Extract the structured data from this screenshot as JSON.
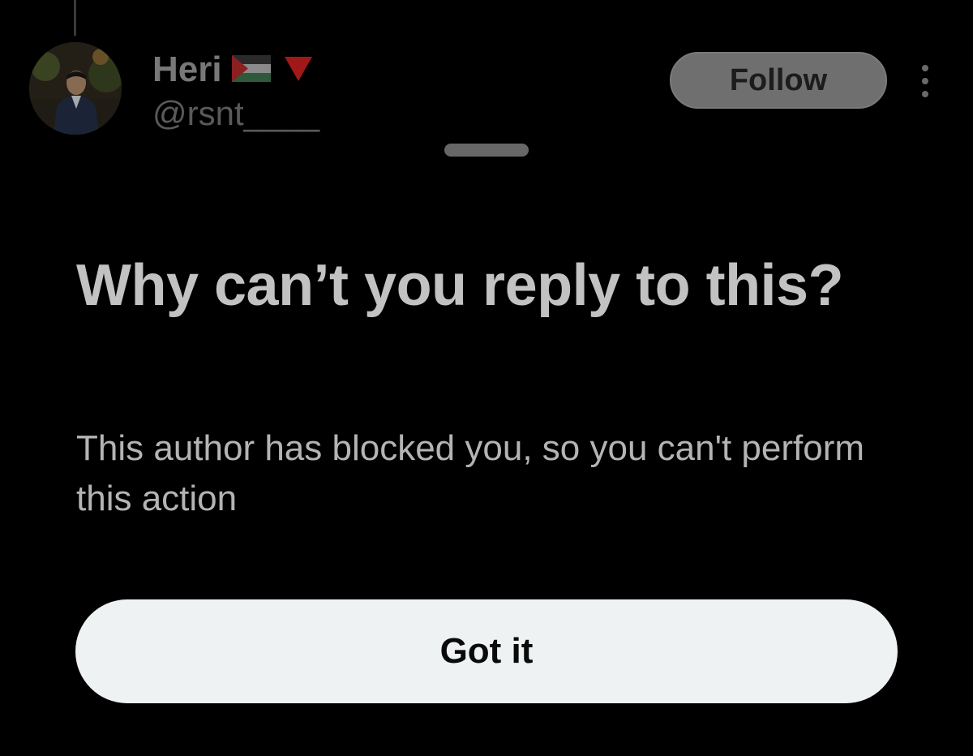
{
  "post_header": {
    "display_name": "Heri",
    "handle": "@rsnt____",
    "follow_label": "Follow",
    "name_icons": [
      "palestine-flag-icon",
      "red-triangle-icon"
    ]
  },
  "sheet": {
    "title": "Why can’t you reply to this?",
    "body": "This author has blocked you, so you can't perform this action",
    "confirm_label": "Got it"
  },
  "colors": {
    "background": "#000000",
    "title_text": "#c2c2c2",
    "button_bg": "#eef2f3",
    "button_text": "#0a0a0a",
    "dimmed_follow_bg": "#6f6f6f"
  }
}
